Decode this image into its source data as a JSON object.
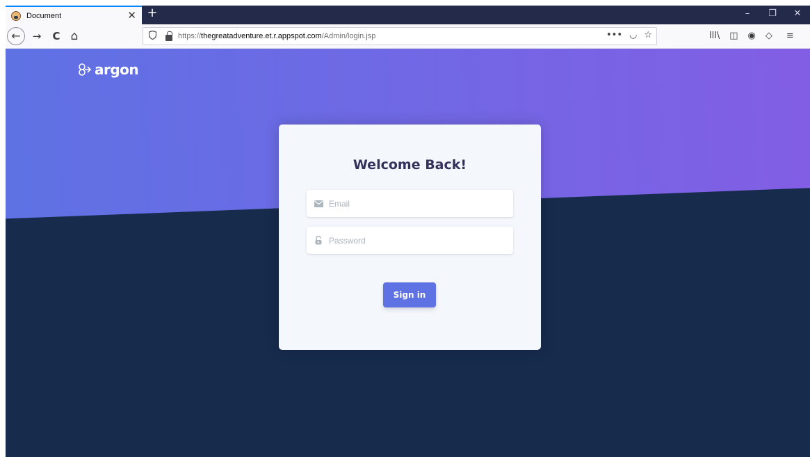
{
  "browser": {
    "tab_title": "Document",
    "tab_close": "✕",
    "new_tab": "+",
    "url_prefix": "https://",
    "url_host": "thegreatadventure.et.r.appspot.com",
    "url_path": "/Admin/login.jsp",
    "controls": {
      "minimize": "–",
      "restore": "❐",
      "close": "✕"
    }
  },
  "nav": {
    "back": "←",
    "forward": "→",
    "reload": "C",
    "home": "⌂",
    "page_actions": "•••",
    "pocket": "◡",
    "bookmark": "☆",
    "library": "lll\\",
    "sidebar": "◫",
    "account": "◉",
    "extension": "◇",
    "menu": "≡"
  },
  "page": {
    "logo_text": "argon",
    "card_title": "Welcome Back!",
    "email_placeholder": "Email",
    "password_placeholder": "Password",
    "signin_label": "Sign in"
  },
  "colors": {
    "hero_start": "#5e72e4",
    "hero_end": "#825ee4",
    "background": "#172b4d",
    "primary_button": "#5e72e4",
    "title": "#32325d"
  }
}
